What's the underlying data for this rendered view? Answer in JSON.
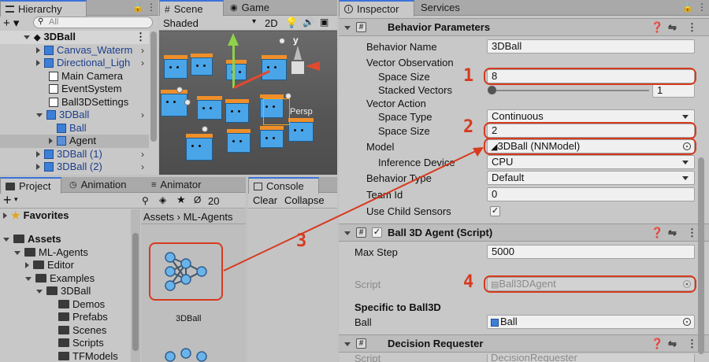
{
  "hierarchy": {
    "tab_label": "Hierarchy",
    "search_placeholder": "All",
    "scene": "3DBall",
    "items": [
      {
        "label": "Canvas_Waterm",
        "type": "prefab"
      },
      {
        "label": "Directional_Ligh",
        "type": "prefab"
      },
      {
        "label": "Main Camera",
        "type": "object"
      },
      {
        "label": "EventSystem",
        "type": "object"
      },
      {
        "label": "Ball3DSettings",
        "type": "object"
      },
      {
        "label": "3DBall",
        "type": "prefab"
      },
      {
        "label": "Ball",
        "type": "prefab-child"
      },
      {
        "label": "Agent",
        "type": "prefab-child"
      },
      {
        "label": "3DBall (1)",
        "type": "prefab"
      },
      {
        "label": "3DBall (2)",
        "type": "prefab"
      }
    ]
  },
  "scene_view": {
    "tab_scene": "Scene",
    "tab_game": "Game",
    "shading": "Shaded",
    "mode_2d": "2D",
    "gizmo_y": "y",
    "persp_label": "Persp"
  },
  "project": {
    "tab_project": "Project",
    "tab_animation": "Animation",
    "tab_animator": "Animator",
    "add_label": "+",
    "visible_count": "20",
    "favorites": "Favorites",
    "assets": "Assets",
    "breadcrumb": [
      "Assets",
      "ML-Agents"
    ],
    "tree": [
      {
        "label": "ML-Agents",
        "depth": 1
      },
      {
        "label": "Editor",
        "depth": 2
      },
      {
        "label": "Examples",
        "depth": 2
      },
      {
        "label": "3DBall",
        "depth": 3
      },
      {
        "label": "Demos",
        "depth": 4
      },
      {
        "label": "Prefabs",
        "depth": 4
      },
      {
        "label": "Scenes",
        "depth": 4
      },
      {
        "label": "Scripts",
        "depth": 4
      },
      {
        "label": "TFModels",
        "depth": 4
      }
    ],
    "asset_name": "3DBall"
  },
  "console": {
    "tab_label": "Console",
    "clear": "Clear",
    "collapse": "Collapse"
  },
  "inspector": {
    "tab_inspector": "Inspector",
    "tab_services": "Services",
    "behavior_parameters": {
      "title": "Behavior Parameters",
      "behavior_name_label": "Behavior Name",
      "behavior_name": "3DBall",
      "vector_observation_label": "Vector Observation",
      "space_size_label": "Space Size",
      "obs_space_size": "8",
      "stacked_vectors_label": "Stacked Vectors",
      "stacked_vectors": "1",
      "vector_action_label": "Vector Action",
      "space_type_label": "Space Type",
      "space_type": "Continuous",
      "action_space_size": "2",
      "model_label": "Model",
      "model": "3DBall (NNModel)",
      "inference_device_label": "Inference Device",
      "inference_device": "CPU",
      "behavior_type_label": "Behavior Type",
      "behavior_type": "Default",
      "team_id_label": "Team Id",
      "team_id": "0",
      "use_child_sensors_label": "Use Child Sensors"
    },
    "ball_agent": {
      "title": "Ball 3D Agent (Script)",
      "max_step_label": "Max Step",
      "max_step": "5000",
      "script_label": "Script",
      "script": "Ball3DAgent",
      "specific_label": "Specific to Ball3D",
      "ball_label": "Ball",
      "ball": "Ball"
    },
    "decision_requester": {
      "title": "Decision Requester",
      "script_label": "Script",
      "script": "DecisionRequester"
    }
  },
  "annotations": {
    "n1": "1",
    "n2": "2",
    "n3": "3",
    "n4": "4",
    "color": "#d63a1f"
  }
}
